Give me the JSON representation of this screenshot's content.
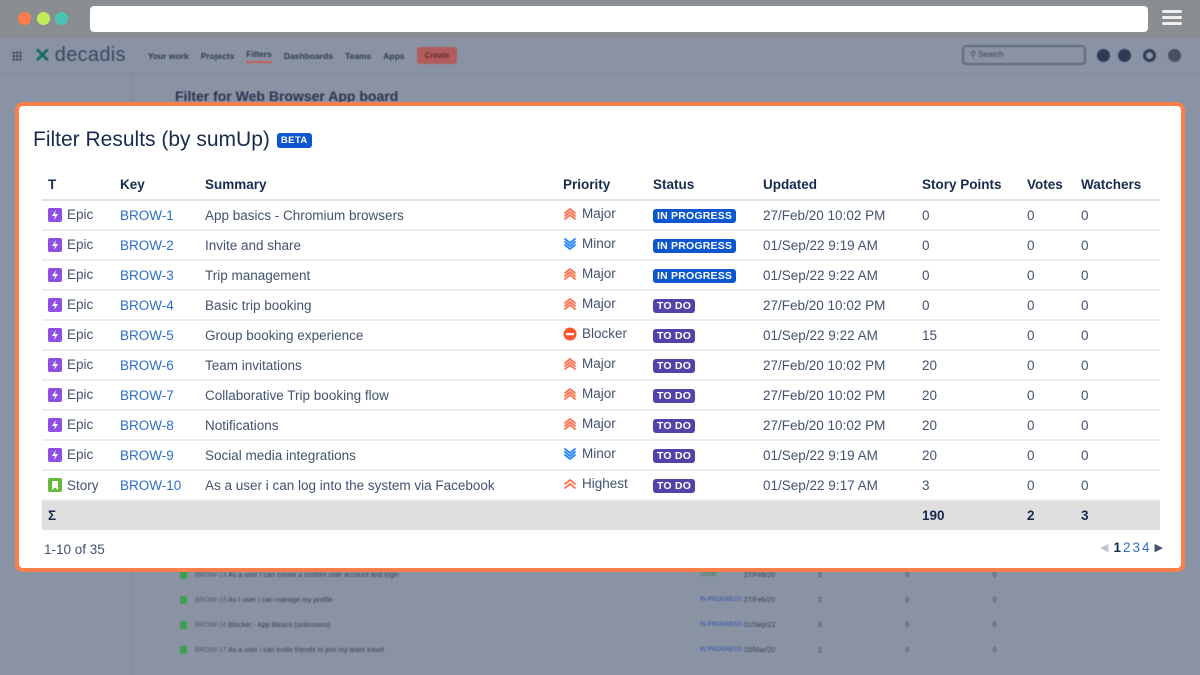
{
  "browser": {
    "icons": [
      "close-dot",
      "minimize-dot",
      "maximize-dot",
      "menu-icon"
    ]
  },
  "background_app": {
    "logo_text": "decadis",
    "nav": [
      "Your work",
      "Projects",
      "Filters",
      "Dashboards",
      "Teams",
      "Apps"
    ],
    "create_label": "Create",
    "search_placeholder": "Search",
    "page_title": "Filter for Web Browser App board",
    "rows": [
      {
        "key": "BROW-14",
        "summary": "As a user I can create a custom user account and login",
        "status": "DONE",
        "updated": "27/Feb/20",
        "points": "3",
        "votes": "0",
        "watchers": "0"
      },
      {
        "key": "BROW-15",
        "summary": "As I user I can manage my profile",
        "status": "IN PROGRESS",
        "updated": "27/Feb/20",
        "points": "2",
        "votes": "0",
        "watchers": "0"
      },
      {
        "key": "BROW-16",
        "summary": "Blocker - App Basics (unknowns)",
        "status": "IN PROGRESS",
        "updated": "01/Sep/22",
        "points": "3",
        "votes": "0",
        "watchers": "0"
      },
      {
        "key": "BROW-17",
        "summary": "As a user i can invite friends to join my team travel",
        "status": "IN PROGRESS",
        "updated": "10/Mar/20",
        "points": "2",
        "votes": "0",
        "watchers": "0"
      }
    ]
  },
  "modal": {
    "title": "Filter Results (by sumUp)",
    "badge": "BETA",
    "columns": [
      "T",
      "Key",
      "Summary",
      "Priority",
      "Status",
      "Updated",
      "Story Points",
      "Votes",
      "Watchers"
    ],
    "rows": [
      {
        "type": "Epic",
        "key": "BROW-1",
        "summary": "App basics - Chromium browsers",
        "priority": "Major",
        "status": "IN PROGRESS",
        "updated": "27/Feb/20 10:02 PM",
        "points": "0",
        "votes": "0",
        "watchers": "0"
      },
      {
        "type": "Epic",
        "key": "BROW-2",
        "summary": "Invite and share",
        "priority": "Minor",
        "status": "IN PROGRESS",
        "updated": "01/Sep/22 9:19 AM",
        "points": "0",
        "votes": "0",
        "watchers": "0"
      },
      {
        "type": "Epic",
        "key": "BROW-3",
        "summary": "Trip management",
        "priority": "Major",
        "status": "IN PROGRESS",
        "updated": "01/Sep/22 9:22 AM",
        "points": "0",
        "votes": "0",
        "watchers": "0"
      },
      {
        "type": "Epic",
        "key": "BROW-4",
        "summary": "Basic trip booking",
        "priority": "Major",
        "status": "TO DO",
        "updated": "27/Feb/20 10:02 PM",
        "points": "0",
        "votes": "0",
        "watchers": "0"
      },
      {
        "type": "Epic",
        "key": "BROW-5",
        "summary": "Group booking experience",
        "priority": "Blocker",
        "status": "TO DO",
        "updated": "01/Sep/22 9:22 AM",
        "points": "15",
        "votes": "0",
        "watchers": "0"
      },
      {
        "type": "Epic",
        "key": "BROW-6",
        "summary": "Team invitations",
        "priority": "Major",
        "status": "TO DO",
        "updated": "27/Feb/20 10:02 PM",
        "points": "20",
        "votes": "0",
        "watchers": "0"
      },
      {
        "type": "Epic",
        "key": "BROW-7",
        "summary": "Collaborative Trip booking flow",
        "priority": "Major",
        "status": "TO DO",
        "updated": "27/Feb/20 10:02 PM",
        "points": "20",
        "votes": "0",
        "watchers": "0"
      },
      {
        "type": "Epic",
        "key": "BROW-8",
        "summary": "Notifications",
        "priority": "Major",
        "status": "TO DO",
        "updated": "27/Feb/20 10:02 PM",
        "points": "20",
        "votes": "0",
        "watchers": "0"
      },
      {
        "type": "Epic",
        "key": "BROW-9",
        "summary": "Social media integrations",
        "priority": "Minor",
        "status": "TO DO",
        "updated": "01/Sep/22 9:19 AM",
        "points": "20",
        "votes": "0",
        "watchers": "0"
      },
      {
        "type": "Story",
        "key": "BROW-10",
        "summary": "As a user i can log into the system via Facebook",
        "priority": "Highest",
        "status": "TO DO",
        "updated": "01/Sep/22 9:17 AM",
        "points": "3",
        "votes": "0",
        "watchers": "0"
      }
    ],
    "sum_row": {
      "symbol": "Σ",
      "points": "190",
      "votes": "2",
      "watchers": "3"
    },
    "result_count": "1-10 of 35",
    "pagination": {
      "pages": [
        "1",
        "2",
        "3",
        "4"
      ],
      "current": "1"
    }
  },
  "colors": {
    "highlight_border": "#fe7f4b",
    "link": "#2d6ecb",
    "in_progress": "#0c57d0",
    "to_do": "#5243aa",
    "epic": "#904ee2",
    "story": "#63ba3c",
    "priority_major": "#ff7452",
    "priority_minor": "#2684ff",
    "priority_blocker": "#ff5630"
  }
}
